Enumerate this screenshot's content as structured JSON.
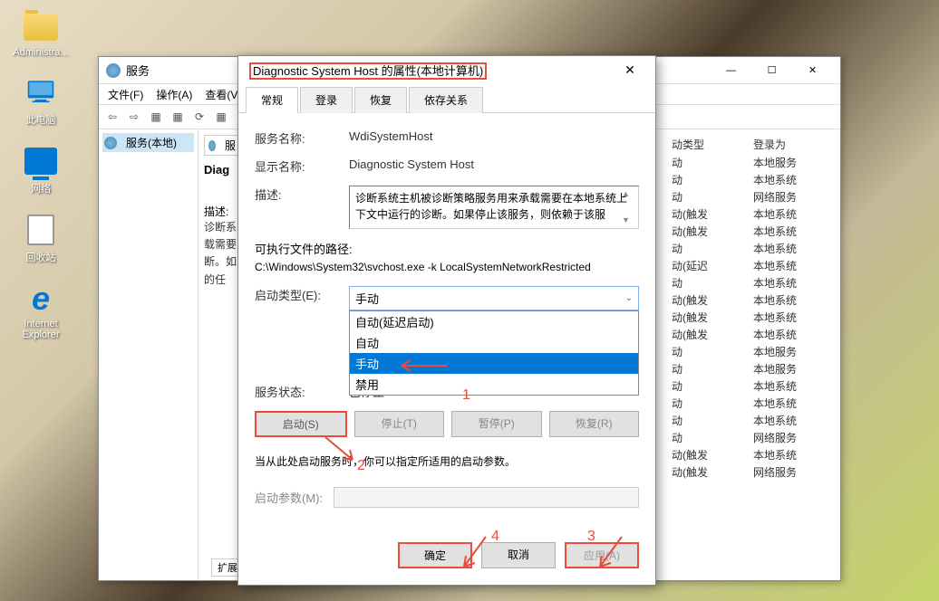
{
  "desktop": {
    "icons": [
      {
        "label": "Administra..."
      },
      {
        "label": "此电脑"
      },
      {
        "label": "网络"
      },
      {
        "label": "回收站"
      },
      {
        "label": "Internet Explorer"
      }
    ]
  },
  "servicesWindow": {
    "title": "服务",
    "menu": {
      "file": "文件(F)",
      "action": "操作(A)",
      "view": "查看(V)"
    },
    "leftPanel": {
      "item": "服务(本地)"
    },
    "centerPanel": {
      "searchLabel": "服",
      "serviceName": "Diag",
      "descLabel": "描述:",
      "descText": "诊断系\n载需要\n断。如\n的任"
    },
    "rightPanel": {
      "headers": {
        "startup": "动类型",
        "logon": "登录为"
      },
      "rows": [
        {
          "startup": "动",
          "logon": "本地服务"
        },
        {
          "startup": "动",
          "logon": "本地系统"
        },
        {
          "startup": "动",
          "logon": "网络服务"
        },
        {
          "startup": "动(触发",
          "logon": "本地系统"
        },
        {
          "startup": "动(触发",
          "logon": "本地系统"
        },
        {
          "startup": "动",
          "logon": "本地系统"
        },
        {
          "startup": "动(延迟",
          "logon": "本地系统"
        },
        {
          "startup": "动",
          "logon": "本地系统"
        },
        {
          "startup": "动(触发",
          "logon": "本地系统"
        },
        {
          "startup": "动(触发",
          "logon": "本地系统"
        },
        {
          "startup": "动(触发",
          "logon": "本地系统"
        },
        {
          "startup": "动",
          "logon": "本地服务"
        },
        {
          "startup": "动",
          "logon": "本地服务"
        },
        {
          "startup": "动",
          "logon": "本地系统"
        },
        {
          "startup": "动",
          "logon": "本地系统"
        },
        {
          "startup": "动",
          "logon": "本地系统"
        },
        {
          "startup": "动",
          "logon": "网络服务"
        },
        {
          "startup": "动(触发",
          "logon": "本地系统"
        },
        {
          "startup": "动(触发",
          "logon": "网络服务"
        }
      ]
    },
    "extTab": "扩展"
  },
  "propsDialog": {
    "title": "Diagnostic System Host 的属性(本地计算机)",
    "tabs": {
      "general": "常规",
      "logon": "登录",
      "recovery": "恢复",
      "deps": "依存关系"
    },
    "labels": {
      "serviceName": "服务名称:",
      "displayName": "显示名称:",
      "description": "描述:",
      "execPath": "可执行文件的路径:",
      "startupType": "启动类型(E):",
      "serviceStatus": "服务状态:",
      "startHint": "当从此处启动服务时，你可以指定所适用的启动参数。",
      "startParams": "启动参数(M):"
    },
    "values": {
      "serviceName": "WdiSystemHost",
      "displayName": "Diagnostic System Host",
      "description": "诊断系统主机被诊断策略服务用来承载需要在本地系统上下文中运行的诊断。如果停止该服务，则依赖于该服",
      "execPath": "C:\\Windows\\System32\\svchost.exe -k LocalSystemNetworkRestricted",
      "startupSelected": "手动",
      "serviceStatus": "已停止"
    },
    "startupOptions": [
      "自动(延迟启动)",
      "自动",
      "手动",
      "禁用"
    ],
    "actionButtons": {
      "start": "启动(S)",
      "stop": "停止(T)",
      "pause": "暂停(P)",
      "resume": "恢复(R)"
    },
    "dialogButtons": {
      "ok": "确定",
      "cancel": "取消",
      "apply": "应用(A)"
    }
  },
  "annotations": {
    "n1": "1",
    "n2": "2",
    "n3": "3",
    "n4": "4"
  }
}
